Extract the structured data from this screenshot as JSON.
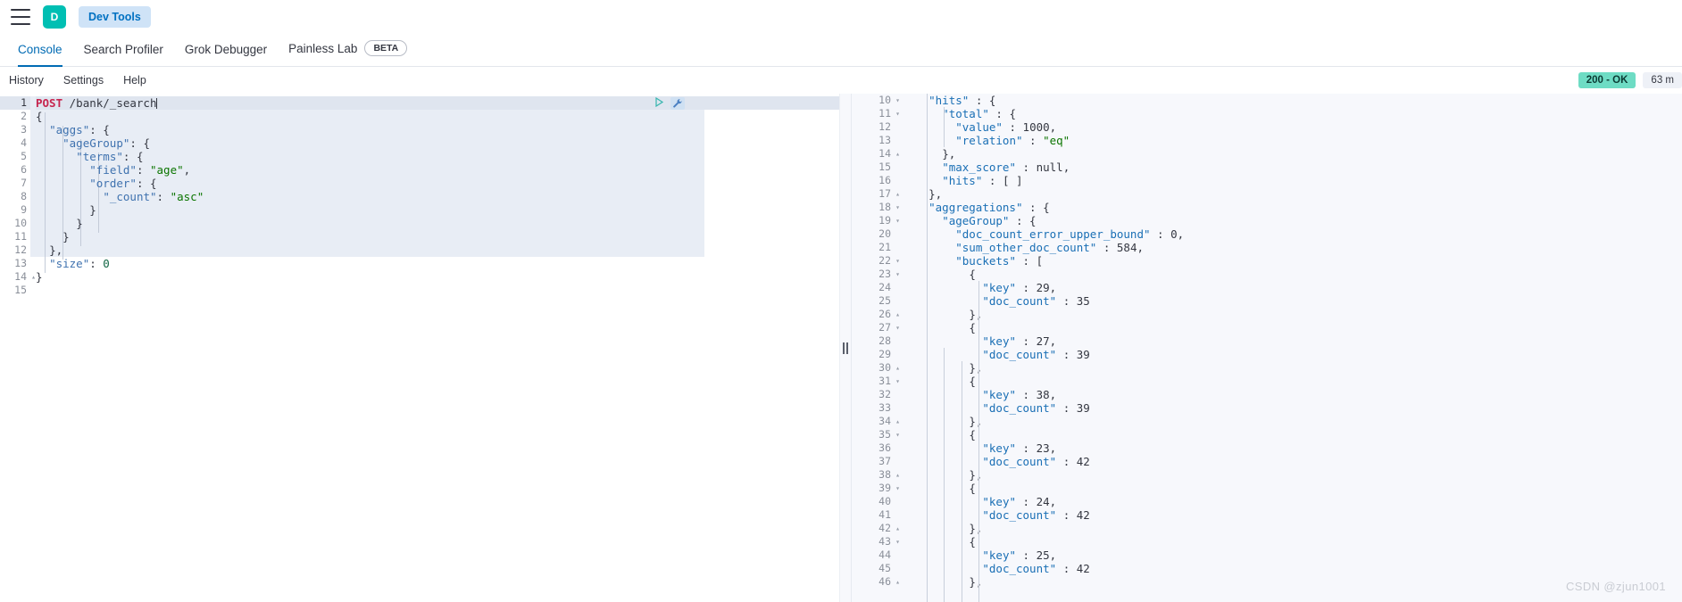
{
  "header": {
    "menu_icon": "hamburger-icon",
    "app_initial": "D",
    "app_name": "Dev Tools"
  },
  "tabs": [
    {
      "label": "Console",
      "active": true,
      "badge": null
    },
    {
      "label": "Search Profiler",
      "active": false,
      "badge": null
    },
    {
      "label": "Grok Debugger",
      "active": false,
      "badge": null
    },
    {
      "label": "Painless Lab",
      "active": false,
      "badge": "BETA"
    }
  ],
  "console_nav": [
    {
      "label": "History"
    },
    {
      "label": "Settings"
    },
    {
      "label": "Help"
    }
  ],
  "status": {
    "code": "200 - OK",
    "time": "63 m",
    "ok_color": "#6edcc4"
  },
  "editor": {
    "actions": {
      "play": "play-icon",
      "wrench": "wrench-icon"
    },
    "lines": [
      {
        "n": "1",
        "fold": "",
        "current": true,
        "text": "POST /bank/_search"
      },
      {
        "n": "2",
        "fold": "▾",
        "current": false,
        "text": "{"
      },
      {
        "n": "3",
        "fold": "▾",
        "current": false,
        "text": "  \"aggs\": {"
      },
      {
        "n": "4",
        "fold": "▾",
        "current": false,
        "text": "    \"ageGroup\": {"
      },
      {
        "n": "5",
        "fold": "▾",
        "current": false,
        "text": "      \"terms\": {"
      },
      {
        "n": "6",
        "fold": "",
        "current": false,
        "text": "        \"field\": \"age\","
      },
      {
        "n": "7",
        "fold": "▾",
        "current": false,
        "text": "        \"order\": {"
      },
      {
        "n": "8",
        "fold": "",
        "current": false,
        "text": "          \"_count\": \"asc\""
      },
      {
        "n": "9",
        "fold": "▴",
        "current": false,
        "text": "        }"
      },
      {
        "n": "10",
        "fold": "▴",
        "current": false,
        "text": "      }"
      },
      {
        "n": "11",
        "fold": "▴",
        "current": false,
        "text": "    }"
      },
      {
        "n": "12",
        "fold": "▴",
        "current": false,
        "text": "  },"
      },
      {
        "n": "13",
        "fold": "",
        "current": false,
        "text": "  \"size\": 0"
      },
      {
        "n": "14",
        "fold": "▴",
        "current": false,
        "text": "}"
      },
      {
        "n": "15",
        "fold": "",
        "current": false,
        "text": ""
      }
    ]
  },
  "response": {
    "lines": [
      {
        "n": "10",
        "fold": "▾",
        "text": "    \"hits\" : {"
      },
      {
        "n": "11",
        "fold": "▾",
        "text": "      \"total\" : {"
      },
      {
        "n": "12",
        "fold": "",
        "text": "        \"value\" : 1000,"
      },
      {
        "n": "13",
        "fold": "",
        "text": "        \"relation\" : \"eq\""
      },
      {
        "n": "14",
        "fold": "▴",
        "text": "      },"
      },
      {
        "n": "15",
        "fold": "",
        "text": "      \"max_score\" : null,"
      },
      {
        "n": "16",
        "fold": "",
        "text": "      \"hits\" : [ ]"
      },
      {
        "n": "17",
        "fold": "▴",
        "text": "    },"
      },
      {
        "n": "18",
        "fold": "▾",
        "text": "    \"aggregations\" : {"
      },
      {
        "n": "19",
        "fold": "▾",
        "text": "      \"ageGroup\" : {"
      },
      {
        "n": "20",
        "fold": "",
        "text": "        \"doc_count_error_upper_bound\" : 0,"
      },
      {
        "n": "21",
        "fold": "",
        "text": "        \"sum_other_doc_count\" : 584,"
      },
      {
        "n": "22",
        "fold": "▾",
        "text": "        \"buckets\" : ["
      },
      {
        "n": "23",
        "fold": "▾",
        "text": "          {"
      },
      {
        "n": "24",
        "fold": "",
        "text": "            \"key\" : 29,"
      },
      {
        "n": "25",
        "fold": "",
        "text": "            \"doc_count\" : 35"
      },
      {
        "n": "26",
        "fold": "▴",
        "text": "          },"
      },
      {
        "n": "27",
        "fold": "▾",
        "text": "          {"
      },
      {
        "n": "28",
        "fold": "",
        "text": "            \"key\" : 27,"
      },
      {
        "n": "29",
        "fold": "",
        "text": "            \"doc_count\" : 39"
      },
      {
        "n": "30",
        "fold": "▴",
        "text": "          },"
      },
      {
        "n": "31",
        "fold": "▾",
        "text": "          {"
      },
      {
        "n": "32",
        "fold": "",
        "text": "            \"key\" : 38,"
      },
      {
        "n": "33",
        "fold": "",
        "text": "            \"doc_count\" : 39"
      },
      {
        "n": "34",
        "fold": "▴",
        "text": "          },"
      },
      {
        "n": "35",
        "fold": "▾",
        "text": "          {"
      },
      {
        "n": "36",
        "fold": "",
        "text": "            \"key\" : 23,"
      },
      {
        "n": "37",
        "fold": "",
        "text": "            \"doc_count\" : 42"
      },
      {
        "n": "38",
        "fold": "▴",
        "text": "          },"
      },
      {
        "n": "39",
        "fold": "▾",
        "text": "          {"
      },
      {
        "n": "40",
        "fold": "",
        "text": "            \"key\" : 24,"
      },
      {
        "n": "41",
        "fold": "",
        "text": "            \"doc_count\" : 42"
      },
      {
        "n": "42",
        "fold": "▴",
        "text": "          },"
      },
      {
        "n": "43",
        "fold": "▾",
        "text": "          {"
      },
      {
        "n": "44",
        "fold": "",
        "text": "            \"key\" : 25,"
      },
      {
        "n": "45",
        "fold": "",
        "text": "            \"doc_count\" : 42"
      },
      {
        "n": "46",
        "fold": "▴",
        "text": "          },"
      }
    ]
  },
  "watermark": "CSDN @zjun1001"
}
